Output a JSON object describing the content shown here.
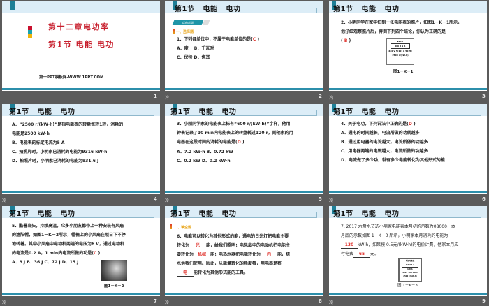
{
  "chapter_title": "第十二章电功率",
  "section_title": "第1节 电能 电功",
  "header_title": "第1节   电能   电功",
  "website": "第一PPT模板网-WWW.1PPT.COM",
  "animation_icon": "冷",
  "colors": {
    "accent": "#1e7f97",
    "answer": "#e0302a",
    "section": "#e8a417"
  },
  "slides": [
    {
      "number": "1"
    },
    {
      "number": "2",
      "tag": "达标巩固",
      "section": "一、选择题",
      "q": "1．下列各单位中，不属于电能单位的是(",
      "answer": "C",
      "close": " )",
      "opts": [
        "A．度　 B．千瓦时",
        "C．伏特 D．焦耳"
      ]
    },
    {
      "number": "3",
      "lines": [
        "2．小明同学在家中拍到一张电能表的照片，如图1－K－1所示，",
        "他仔细观察照片后，得到下列四个结论，你认为正确的是"
      ],
      "open": "( ",
      "answer": "B",
      "close": " )",
      "figure": "图1－K－1",
      "meter": [
        "kW·h",
        "0 9 3 1 6",
        "220 V 5(10) A 50 Hz",
        "2500 r/(kW·h)"
      ]
    },
    {
      "number": "4",
      "lines": [
        "A．“2500 r/(kW·h)”是指电能表的转盘每转1转，消耗的",
        "电能是2500 kW·h",
        "B．电能表的标定电流为5 A",
        "C．拍照片时，小明家已消耗的电能为9316 kW·h",
        "D．拍照片时，小明家已消耗的电能为931.6 J"
      ]
    },
    {
      "number": "5",
      "lines": [
        "3．小刚同学家的电能表上标有“600 r/(kW·h)”字样，他用",
        "钟表记录了10 min内电能表上的转盘转过120 r，则他家的用"
      ],
      "q": "电器在这段时间内消耗的电能是(",
      "answer": "D",
      "close": " )",
      "opts": [
        "A．7.2 kW·h  B．0.72 kW",
        "C．0.2 kW  D．0.2 kW·h"
      ]
    },
    {
      "number": "6",
      "q": "4．关于电功，下列说法中正确的是(",
      "answer": "D",
      "close": " )",
      "opts": [
        "A．通电的时间越长，电流所做的功就越多",
        "B．通过用电器的电流越大，电流所做的功越多",
        "C．用电器两端的电压越大，电流所做的功越多",
        "D．电流做了多少功，就有多少电能转化为其他形式的能"
      ]
    },
    {
      "number": "7",
      "lines": [
        "5．酷暑当头，持续高温，众多小朋友都带上一种安装有风扇",
        "的遮阳帽，如图1－K－2所示，帽檐上的小风扇在烈日下不停",
        "地转着。其中小风扇中电动机两端的电压为6 V，通过电动机"
      ],
      "q": "的电流是0.2 A，1 min内电流所做的功是(",
      "answer": "C",
      "close": " )",
      "opts": [
        "A．8 J  B．36 J  C．72 J  D．15 J"
      ],
      "figure": "图1－K－2"
    },
    {
      "number": "8",
      "section": "二、填空题",
      "l1": "6．电能可以转化为其他形式的能，通电的日光灯把电能主要",
      "l2a": "转化为",
      "a1": "光",
      "l2b": "能，给我们照明；电风扇中的电动机把电能主",
      "l3a": "要转化为",
      "a2": "机械",
      "l3b": "能；电热水器把电能转化为",
      "a3": "内",
      "l3c": "能，烧",
      "l4": "水供我们使用。因此，从能量转化的角度看，用电器是将",
      "a4": "电",
      "l5": "能转化为其他形式能的工具。"
    },
    {
      "number": "9",
      "l1": "7. 2017·六盘水节选小明家电能表本月初的示数为08000，本",
      "l2": "月底的示数如图 1－K－3 所示，小明家本月消耗的电能为",
      "a1": "130",
      "l3": "kW·h，如果按 0.5元/(kW·h)的电价计费，他家本月应",
      "l4a": "付电费",
      "a2": "65",
      "l4b": "元。",
      "figure": "图 1－K－3",
      "meter": [
        "单相电能表",
        "0 9 3 1 6",
        "kW·h",
        "220V 10A 50Hz",
        "2500 r/(kW·h)"
      ]
    }
  ]
}
